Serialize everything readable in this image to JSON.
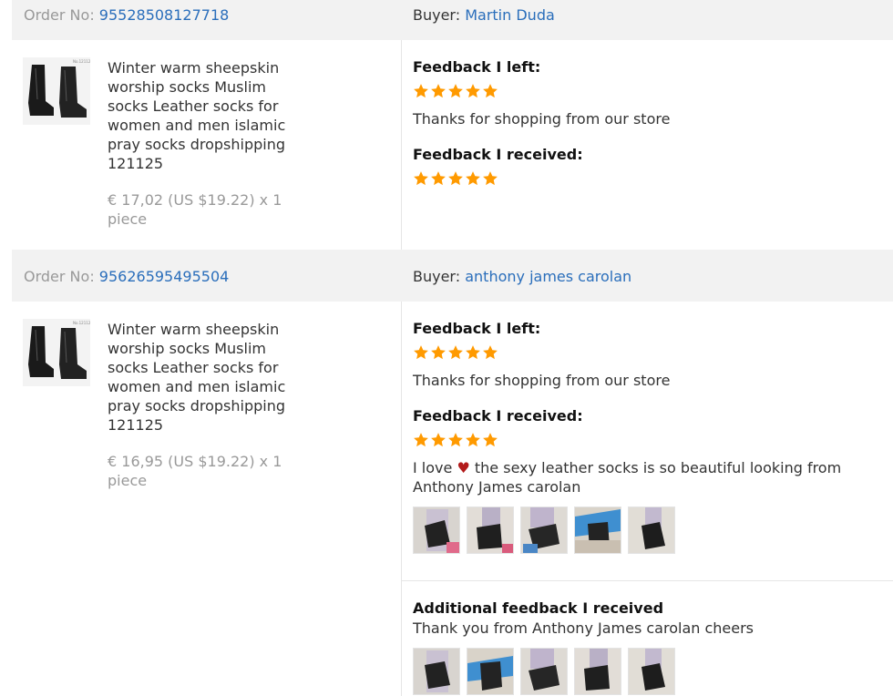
{
  "orders": [
    {
      "order_no_label": "Order No:",
      "order_no": "95528508127718",
      "buyer_label": "Buyer:",
      "buyer_name": "Martin Duda",
      "product_title": "Winter warm sheepskin worship socks Muslim socks Leather socks for women and men islamic pray socks dropshipping 121125",
      "price": "€ 17,02 (US $19.22) x 1 piece",
      "feedback_left_label": "Feedback I left:",
      "feedback_left_rating": 5,
      "feedback_left_text": "Thanks for shopping from our store",
      "feedback_received_label": "Feedback I received:",
      "feedback_received_rating": 5
    },
    {
      "order_no_label": "Order No:",
      "order_no": "95626595495504",
      "buyer_label": "Buyer:",
      "buyer_name": "anthony james carolan",
      "product_title": "Winter warm sheepskin worship socks Muslim socks Leather socks for women and men islamic pray socks dropshipping 121125",
      "price": "€ 16,95 (US $19.22) x 1 piece",
      "feedback_left_label": "Feedback I left:",
      "feedback_left_rating": 5,
      "feedback_left_text": "Thanks for shopping from our store",
      "feedback_received_label": "Feedback I received:",
      "feedback_received_rating": 5,
      "feedback_received_text_before": "I love",
      "feedback_received_heart": "♥",
      "feedback_received_text_after": "the sexy leather socks is so beautiful looking from Anthony James carolan",
      "additional_label": "Additional feedback I received",
      "additional_text": "Thank you from Anthony James carolan cheers"
    }
  ],
  "colors": {
    "link": "#2a6ebb",
    "star": "#ff9a00",
    "header_bg": "#f2f2f2",
    "heart": "#b31b1b"
  },
  "icons": {
    "star": "star-icon",
    "product": "boot-socks-thumbnail"
  }
}
